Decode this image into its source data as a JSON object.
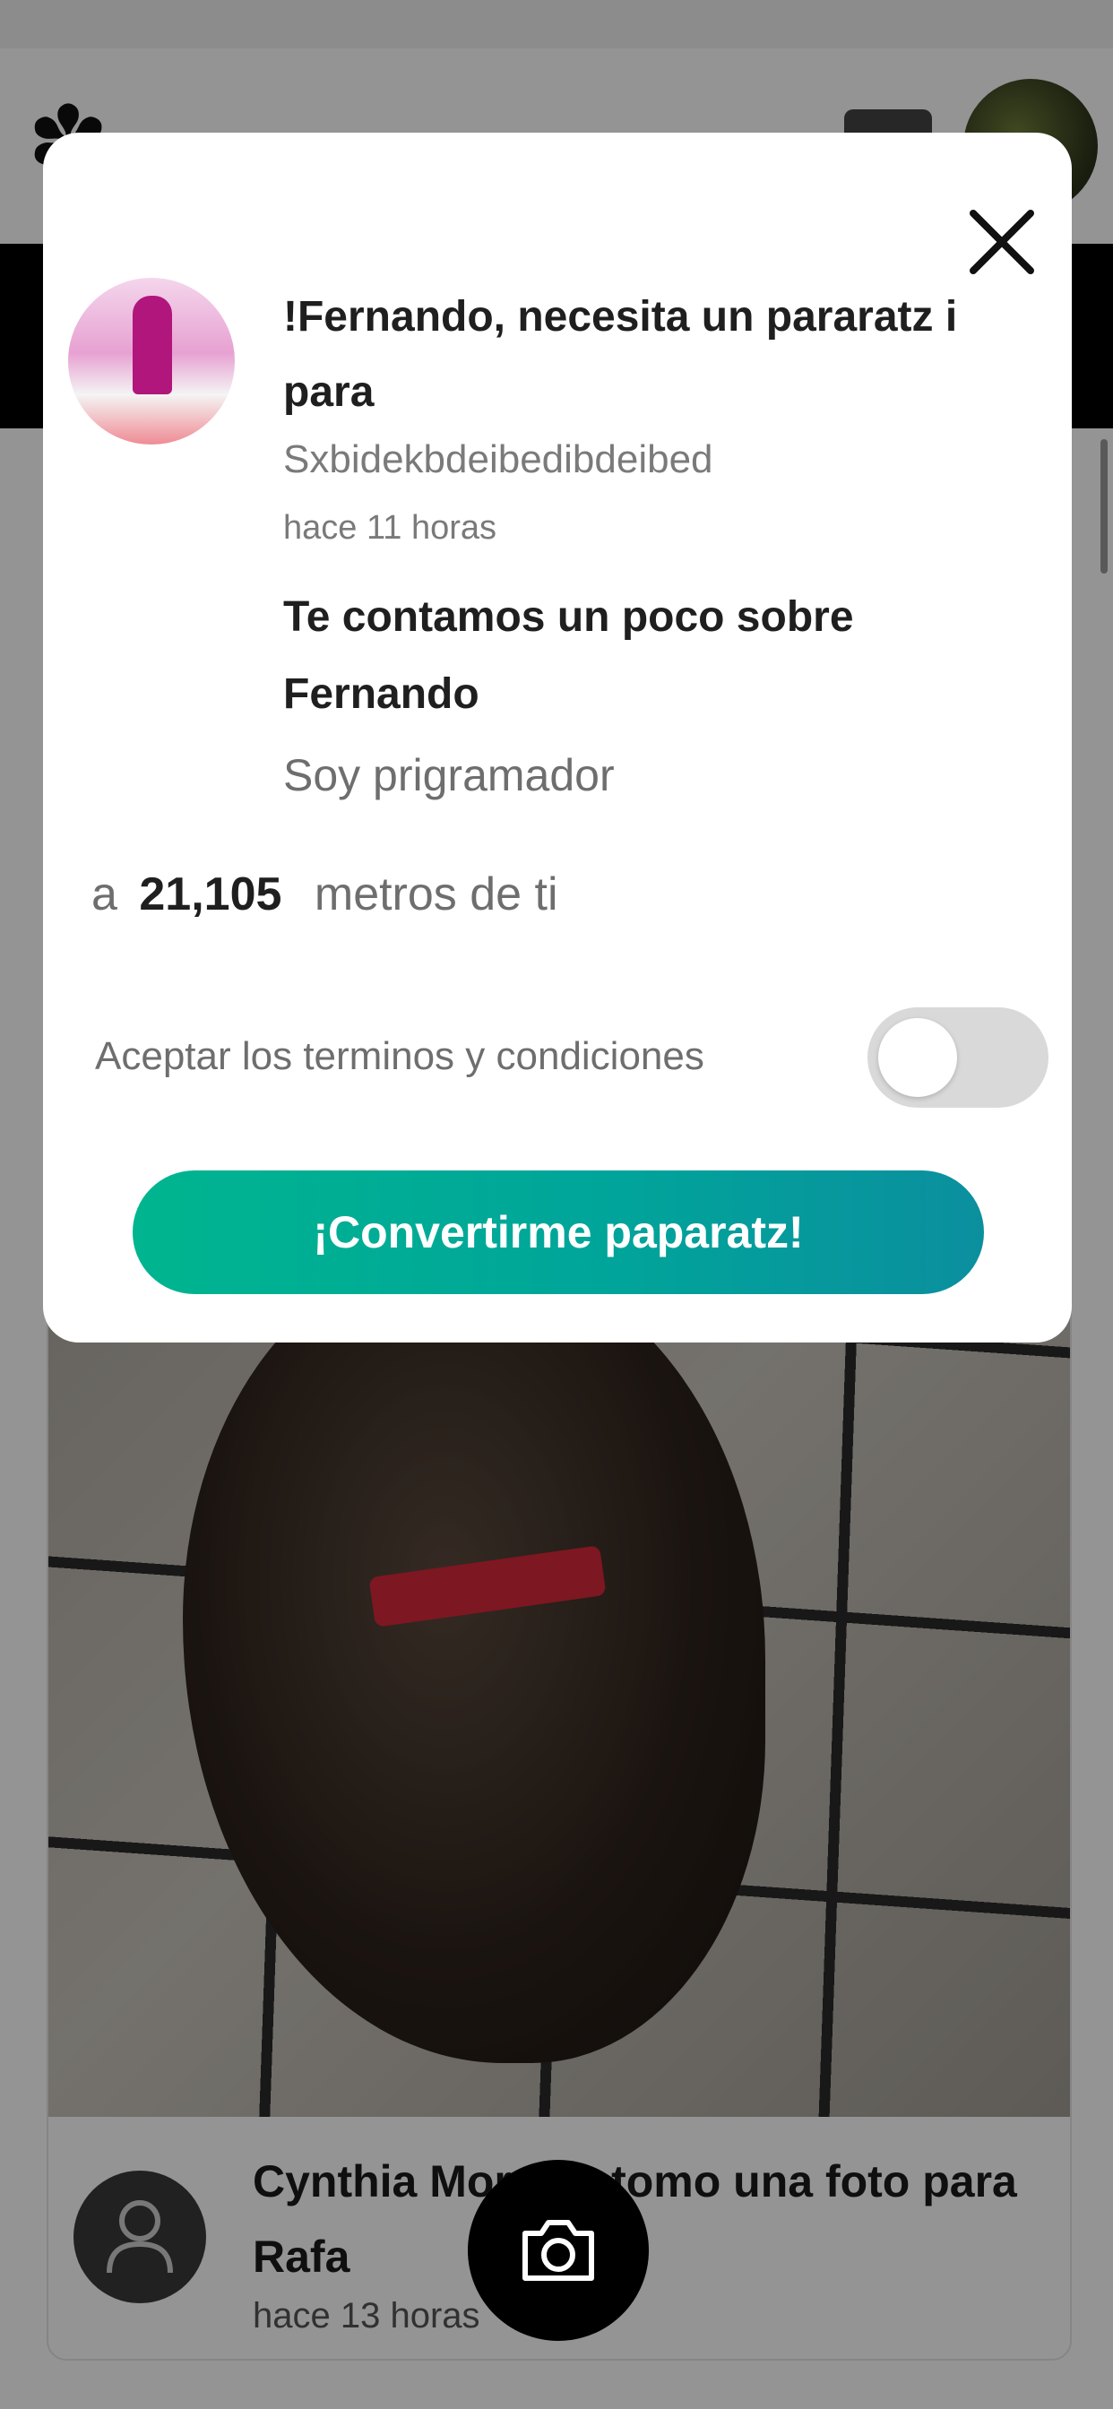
{
  "modal": {
    "title": "!Fernando, necesita un pararatz i para",
    "subtitle": "Sxbidekbdeibedibdeibed",
    "time_ago": "hace 11 horas",
    "about_heading": "Te contamos un poco sobre Fernando",
    "about_text": "Soy prigramador",
    "distance_prefix": "a",
    "distance_value": "21,105",
    "distance_suffix": "metros de ti",
    "terms_label": "Aceptar los terminos y condiciones",
    "terms_accepted": false,
    "cta_label": "¡Convertirme paparatz!",
    "close_icon": "close-icon"
  },
  "feed": {
    "post_title": "Cynthia Morales tomo una foto para Rafa",
    "post_time": "hace 13 horas"
  },
  "icons": {
    "camera": "camera-icon",
    "user": "user-icon",
    "menu": "menu-icon"
  },
  "colors": {
    "cta_start": "#00b58f",
    "cta_end": "#0b8f9e",
    "overlay": "rgba(0,0,0,0.42)"
  }
}
